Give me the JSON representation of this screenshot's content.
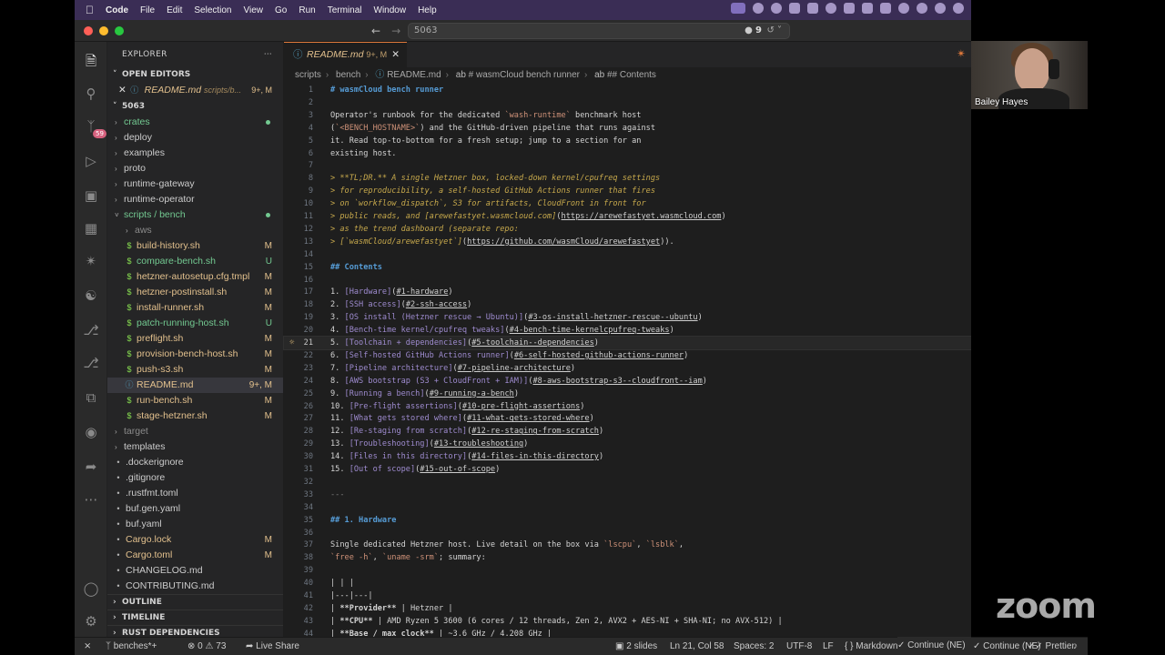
{
  "menubar": {
    "app": "Code",
    "items": [
      "File",
      "Edit",
      "Selection",
      "View",
      "Go",
      "Run",
      "Terminal",
      "Window",
      "Help"
    ]
  },
  "titlebar": {
    "search": "5063",
    "badge": "9"
  },
  "activity_badge": "59",
  "sidebar": {
    "title": "EXPLORER",
    "open_editors": "OPEN EDITORS",
    "open_file": "README.md",
    "open_file_path": "scripts/b...",
    "open_file_status": "9+, M",
    "workspace": "5063",
    "tree": [
      {
        "label": "crates",
        "kind": "folder",
        "status": "dot-green"
      },
      {
        "label": "deploy",
        "kind": "folder"
      },
      {
        "label": "examples",
        "kind": "folder"
      },
      {
        "label": "proto",
        "kind": "folder"
      },
      {
        "label": "runtime-gateway",
        "kind": "folder"
      },
      {
        "label": "runtime-operator",
        "kind": "folder"
      },
      {
        "label": "scripts / bench",
        "kind": "folder-open",
        "status": "dot-green"
      },
      {
        "label": "aws",
        "kind": "subfolder"
      },
      {
        "label": "build-history.sh",
        "kind": "file",
        "status": "M"
      },
      {
        "label": "compare-bench.sh",
        "kind": "file",
        "status": "U"
      },
      {
        "label": "hetzner-autosetup.cfg.tmpl",
        "kind": "file",
        "status": "M"
      },
      {
        "label": "hetzner-postinstall.sh",
        "kind": "file",
        "status": "M"
      },
      {
        "label": "install-runner.sh",
        "kind": "file",
        "status": "M"
      },
      {
        "label": "patch-running-host.sh",
        "kind": "file",
        "status": "U"
      },
      {
        "label": "preflight.sh",
        "kind": "file",
        "status": "M"
      },
      {
        "label": "provision-bench-host.sh",
        "kind": "file",
        "status": "M"
      },
      {
        "label": "push-s3.sh",
        "kind": "file",
        "status": "M"
      },
      {
        "label": "README.md",
        "kind": "file-selected",
        "status": "9+, M"
      },
      {
        "label": "run-bench.sh",
        "kind": "file",
        "status": "M"
      },
      {
        "label": "stage-hetzner.sh",
        "kind": "file",
        "status": "M"
      },
      {
        "label": "target",
        "kind": "folder-dim"
      },
      {
        "label": "templates",
        "kind": "folder"
      },
      {
        "label": ".dockerignore",
        "kind": "root-file"
      },
      {
        "label": ".gitignore",
        "kind": "root-file"
      },
      {
        "label": ".rustfmt.toml",
        "kind": "root-file"
      },
      {
        "label": "buf.gen.yaml",
        "kind": "root-file"
      },
      {
        "label": "buf.yaml",
        "kind": "root-file"
      },
      {
        "label": "Cargo.lock",
        "kind": "root-file",
        "status": "M"
      },
      {
        "label": "Cargo.toml",
        "kind": "root-file",
        "status": "M"
      },
      {
        "label": "CHANGELOG.md",
        "kind": "root-file"
      },
      {
        "label": "CONTRIBUTING.md",
        "kind": "root-file"
      }
    ],
    "outline": "OUTLINE",
    "timeline": "TIMELINE",
    "rust_deps": "RUST DEPENDENCIES"
  },
  "tab": {
    "label": "README.md",
    "status": "9+, M"
  },
  "breadcrumbs": [
    "scripts",
    "bench",
    "README.md",
    "# wasmCloud bench runner",
    "## Contents"
  ],
  "code_lines": [
    {
      "n": "1",
      "html": "<span class='h'># wasmCloud bench runner</span>"
    },
    {
      "n": "2",
      "html": ""
    },
    {
      "n": "3",
      "html": "Operator's runbook for the dedicated <span class='cd'>`wash-runtime`</span> benchmark host"
    },
    {
      "n": "4",
      "html": "(<span class='cd'>`&lt;BENCH_HOSTNAME&gt;`</span>) and the GitHub-driven pipeline that runs against"
    },
    {
      "n": "5",
      "html": "it. Read top-to-bottom for a fresh setup; jump to a section for an"
    },
    {
      "n": "6",
      "html": "existing host."
    },
    {
      "n": "7",
      "html": ""
    },
    {
      "n": "8",
      "html": "<span class='q'>&gt; **TL;DR.** A single Hetzner box, locked-down kernel/cpufreq settings</span>"
    },
    {
      "n": "9",
      "html": "<span class='q'>&gt; for reproducibility, a self-hosted GitHub Actions runner that fires</span>"
    },
    {
      "n": "10",
      "html": "<span class='q'>&gt; on `workflow_dispatch`, S3 for artifacts, CloudFront in front for</span>"
    },
    {
      "n": "11",
      "html": "<span class='q'>&gt; public reads, and [arewefastyet.wasmcloud.com]</span>(<span class='url'>https://arewefastyet.wasmcloud.com</span>)"
    },
    {
      "n": "12",
      "html": "<span class='q'>&gt; as the trend dashboard (separate repo:</span>"
    },
    {
      "n": "13",
      "html": "<span class='q'>&gt; [`wasmCloud/arewefastyet`]</span>(<span class='url'>https://github.com/wasmCloud/arewefastyet</span>))."
    },
    {
      "n": "14",
      "html": ""
    },
    {
      "n": "15",
      "html": "<span class='h'>## Contents</span>"
    },
    {
      "n": "16",
      "html": ""
    },
    {
      "n": "17",
      "html": "1. <span class='lk'>[Hardware]</span>(<span class='url'>#1-hardware</span>)"
    },
    {
      "n": "18",
      "html": "2. <span class='lk'>[SSH access]</span>(<span class='url'>#2-ssh-access</span>)"
    },
    {
      "n": "19",
      "html": "3. <span class='lk'>[OS install (Hetzner rescue → Ubuntu)]</span>(<span class='url'>#3-os-install-hetzner-rescue--ubuntu</span>)"
    },
    {
      "n": "20",
      "html": "4. <span class='lk'>[Bench-time kernel/cpufreq tweaks]</span>(<span class='url'>#4-bench-time-kernelcpufreq-tweaks</span>)"
    },
    {
      "n": "21",
      "html": "5. <span class='lk'>[Toolchain + dependencies]</span>(<span class='url'>#5-toolchain--dependencies</span>)",
      "current": true
    },
    {
      "n": "22",
      "html": "6. <span class='lk'>[Self-hosted GitHub Actions runner]</span>(<span class='url'>#6-self-hosted-github-actions-runner</span>)"
    },
    {
      "n": "23",
      "html": "7. <span class='lk'>[Pipeline architecture]</span>(<span class='url'>#7-pipeline-architecture</span>)"
    },
    {
      "n": "24",
      "html": "8. <span class='lk'>[AWS bootstrap (S3 + CloudFront + IAM)]</span>(<span class='url'>#8-aws-bootstrap-s3--cloudfront--iam</span>)"
    },
    {
      "n": "25",
      "html": "9. <span class='lk'>[Running a bench]</span>(<span class='url'>#9-running-a-bench</span>)"
    },
    {
      "n": "26",
      "html": "10. <span class='lk'>[Pre-flight assertions]</span>(<span class='url'>#10-pre-flight-assertions</span>)"
    },
    {
      "n": "27",
      "html": "11. <span class='lk'>[What gets stored where]</span>(<span class='url'>#11-what-gets-stored-where</span>)"
    },
    {
      "n": "28",
      "html": "12. <span class='lk'>[Re-staging from scratch]</span>(<span class='url'>#12-re-staging-from-scratch</span>)"
    },
    {
      "n": "29",
      "html": "13. <span class='lk'>[Troubleshooting]</span>(<span class='url'>#13-troubleshooting</span>)"
    },
    {
      "n": "30",
      "html": "14. <span class='lk'>[Files in this directory]</span>(<span class='url'>#14-files-in-this-directory</span>)"
    },
    {
      "n": "31",
      "html": "15. <span class='lk'>[Out of scope]</span>(<span class='url'>#15-out-of-scope</span>)"
    },
    {
      "n": "32",
      "html": ""
    },
    {
      "n": "33",
      "html": "<span class='rule'>---</span>"
    },
    {
      "n": "34",
      "html": ""
    },
    {
      "n": "35",
      "html": "<span class='h'>## 1. Hardware</span>"
    },
    {
      "n": "36",
      "html": ""
    },
    {
      "n": "37",
      "html": "Single dedicated Hetzner host. Live detail on the box via <span class='cd'>`lscpu`</span>, <span class='cd'>`lsblk`</span>,"
    },
    {
      "n": "38",
      "html": "<span class='cd'>`free -h`</span>, <span class='cd'>`uname -srm`</span>; summary:"
    },
    {
      "n": "39",
      "html": ""
    },
    {
      "n": "40",
      "html": "| | |"
    },
    {
      "n": "41",
      "html": "|---|---|"
    },
    {
      "n": "42",
      "html": "| <b>**Provider**</b> | Hetzner |"
    },
    {
      "n": "43",
      "html": "| <b>**CPU**</b> | AMD Ryzen 5 3600 (6 cores / 12 threads, Zen 2, AVX2 + AES-NI + SHA-NI; no AVX-512) |"
    },
    {
      "n": "44",
      "html": "| <b>**Base / max clock**</b> | ~3.6 GHz / 4.208 GHz |"
    }
  ],
  "statusbar": {
    "branch": "benches*+",
    "errors": "0",
    "warnings": "73",
    "live_share": "Live Share",
    "slides": "2 slides",
    "position": "Ln 21, Col 58",
    "spaces": "Spaces: 2",
    "encoding": "UTF-8",
    "eol": "LF",
    "language": "Markdown",
    "continue": "Continue (NE)",
    "formatter": "Prettier"
  },
  "participant": "Bailey Hayes",
  "zoom_logo": "zoom"
}
